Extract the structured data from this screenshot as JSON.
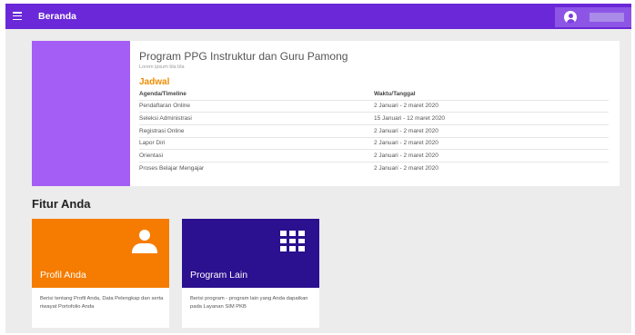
{
  "topbar": {
    "title": "Beranda",
    "menu_icon": "menu-icon",
    "avatar_icon": "account-circle-icon",
    "color": "#6a28d8"
  },
  "program": {
    "title": "Program PPG Instruktur dan Guru Pamong",
    "subtitle": "Lorem ipsum bla bla",
    "schedule_heading": "Jadwal",
    "columns": [
      "Agenda/Timeline",
      "Waktu/Tanggal"
    ],
    "rows": [
      [
        "Pendaftaran Online",
        "2 Januari - 2 maret 2020"
      ],
      [
        "Seleksi Administrasi",
        "15 Januari - 12 maret 2020"
      ],
      [
        "Registrasi Online",
        "2 Januari - 2 maret 2020"
      ],
      [
        "Lapor Diri",
        "2 Januari - 2 maret 2020"
      ],
      [
        "Orientasi",
        "2 Januari - 2 maret 2020"
      ],
      [
        "Proses Belajar Mengajar",
        "2 Januari - 2 maret 2020"
      ]
    ],
    "accent_color": "#a55ef5",
    "heading_color": "#f08b00"
  },
  "features": {
    "section_title": "Fitur Anda",
    "items": [
      {
        "title": "Profil Anda",
        "description": "Berisi tentang Profil Anda, Data Pelengkap dan serta riwayat Portofolio Anda",
        "icon": "person-icon",
        "color": "#f57c00"
      },
      {
        "title": "Program Lain",
        "description": "Berisi program - program lain yang Anda dapatkan pada Layanan SIM PKB",
        "icon": "apps-grid-icon",
        "color": "#2b108f"
      }
    ]
  }
}
